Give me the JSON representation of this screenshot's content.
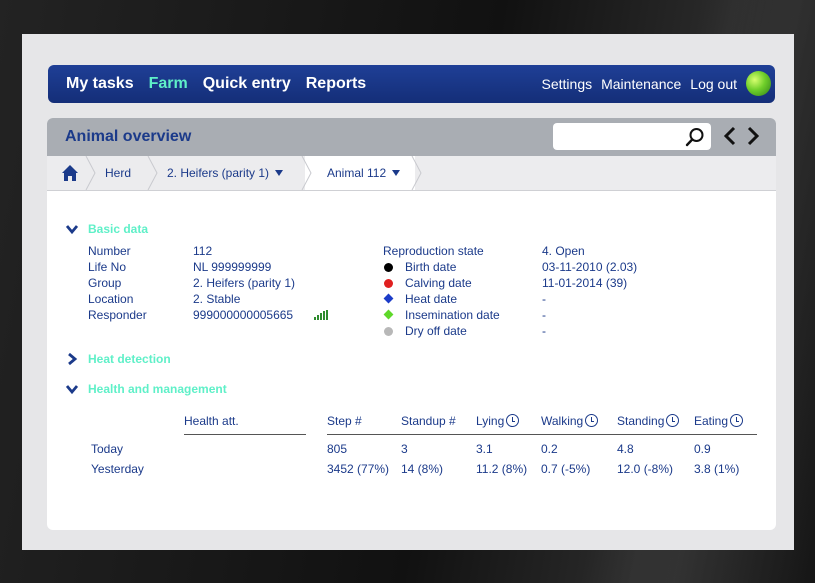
{
  "nav": {
    "left": [
      "My tasks",
      "Farm",
      "Quick entry",
      "Reports"
    ],
    "right": [
      "Settings",
      "Maintenance",
      "Log out"
    ]
  },
  "panel": {
    "title": "Animal overview",
    "search_placeholder": ""
  },
  "breadcrumb": {
    "herd": "Herd",
    "group": "2. Heifers (parity 1)",
    "animal": "Animal 112"
  },
  "basic": {
    "title": "Basic data",
    "number_label": "Number",
    "number_value": "112",
    "lifeno_label": "Life No",
    "lifeno_value": "NL 999999999",
    "group_label": "Group",
    "group_value": "2. Heifers (parity 1)",
    "location_label": "Location",
    "location_value": "2. Stable",
    "responder_label": "Responder",
    "responder_value": "999000000005665",
    "repro_label": "Reproduction state",
    "repro_value": "4. Open",
    "birth_label": "Birth date",
    "birth_value": "03-11-2010 (2.03)",
    "calving_label": "Calving date",
    "calving_value": "11-01-2014 (39)",
    "heat_label": "Heat date",
    "heat_value": "-",
    "insem_label": "Insemination date",
    "insem_value": "-",
    "dryoff_label": "Dry off date",
    "dryoff_value": "-"
  },
  "heat_detection": {
    "title": "Heat detection"
  },
  "health": {
    "title": "Health and management",
    "headers": [
      "Health att.",
      "Step #",
      "Standup #",
      "Lying",
      "Walking",
      "Standing",
      "Eating"
    ],
    "rows": [
      {
        "label": "Today",
        "values": [
          "",
          "805",
          "3",
          "3.1",
          "0.2",
          "4.8",
          "0.9"
        ]
      },
      {
        "label": "Yesterday",
        "values": [
          "",
          "3452 (77%)",
          "14 (8%)",
          "11.2 (8%)",
          "0.7 (-5%)",
          "12.0 (-8%)",
          "3.8 (1%)"
        ]
      }
    ]
  },
  "colors": {
    "brand": "#1b3a8a",
    "accent": "#5ff0c8",
    "birth": "#000000",
    "calving": "#e02020",
    "heat": "#1c3cc8",
    "insemination": "#5fd82a",
    "dryoff": "#b8b8b8"
  }
}
